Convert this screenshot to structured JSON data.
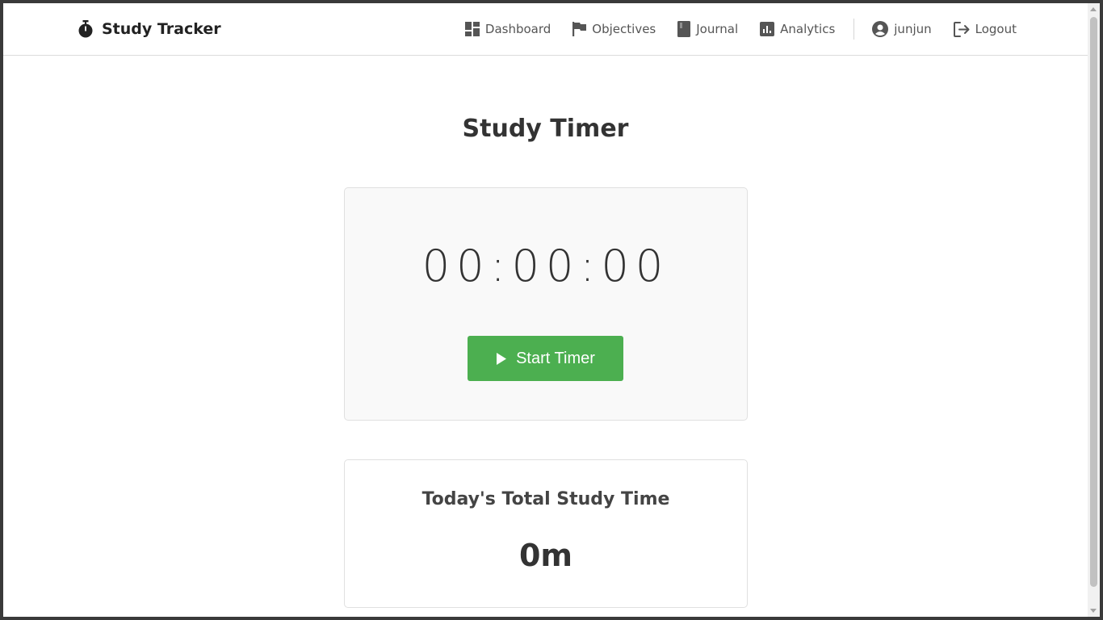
{
  "navbar": {
    "brand": "Study Tracker",
    "brand_icon": "stopwatch-icon",
    "items": [
      {
        "label": "Dashboard",
        "icon": "dashboard-icon"
      },
      {
        "label": "Objectives",
        "icon": "flag-icon"
      },
      {
        "label": "Journal",
        "icon": "book-icon"
      },
      {
        "label": "Analytics",
        "icon": "analytics-icon"
      }
    ],
    "user": {
      "label": "junjun",
      "icon": "user-circle-icon"
    },
    "logout": {
      "label": "Logout",
      "icon": "logout-icon"
    }
  },
  "main": {
    "title": "Study Timer",
    "timer": {
      "display": "00:00:00",
      "start_label": "Start Timer",
      "start_icon": "play-icon"
    },
    "total": {
      "title": "Today's Total Study Time",
      "value": "0m"
    }
  },
  "colors": {
    "accent_green": "#4caf50",
    "text_dark": "#333333",
    "nav_text": "#555555",
    "card_bg": "#f9f9f9",
    "border": "#e0e0e0"
  }
}
